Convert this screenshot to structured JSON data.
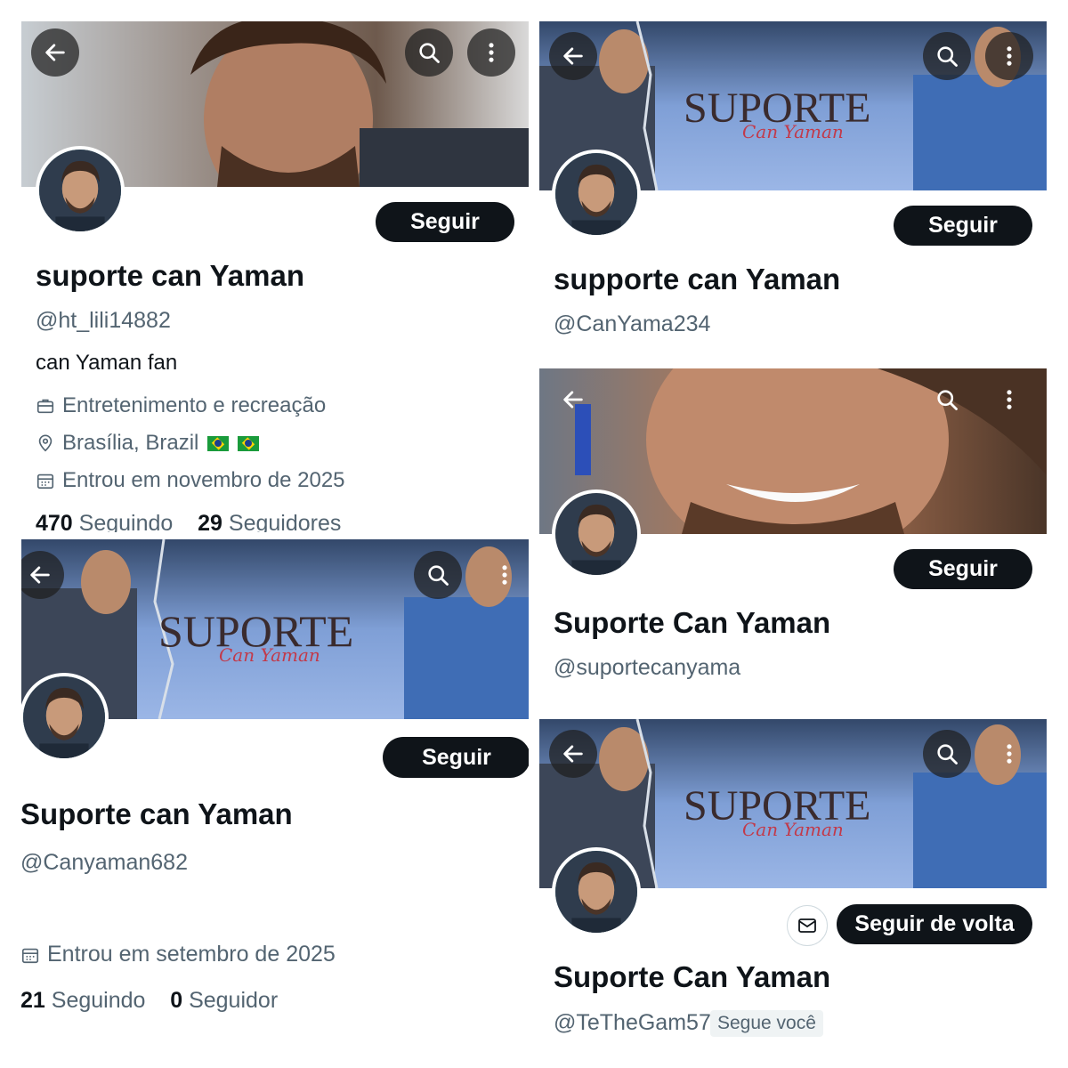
{
  "panels": {
    "p1": {
      "name": "suporte can Yaman",
      "handle": "@ht_lili14882",
      "bio": "can Yaman fan",
      "category": "Entretenimento e recreação",
      "location": "Brasília, Brazil",
      "joined": "Entrou em novembro de 2025",
      "following_count": "470",
      "following_label": "Seguindo",
      "followers_count": "29",
      "followers_label": "Seguidores",
      "follow_label": "Seguir"
    },
    "p2": {
      "name": "supporte can Yaman",
      "handle": "@CanYama234",
      "banner_title": "SUPORTE",
      "banner_sub": "Can Yaman",
      "follow_label": "Seguir"
    },
    "p3": {
      "name": "Suporte can Yaman",
      "handle": "@Canyaman682",
      "banner_title": "SUPORTE",
      "banner_sub": "Can Yaman",
      "joined": "Entrou em setembro de 2025",
      "following_count": "21",
      "following_label": "Seguindo",
      "followers_count": "0",
      "followers_label": "Seguidor",
      "follow_label": "Seguir"
    },
    "p4": {
      "name": "Suporte Can Yaman",
      "handle": "@suportecanyama",
      "follow_label": "Seguir"
    },
    "p5": {
      "name": "Suporte Can Yaman",
      "handle": "@TeTheGam57",
      "follows_you": "Segue você",
      "banner_title": "SUPORTE",
      "banner_sub": "Can Yaman",
      "follow_label": "Seguir de volta"
    }
  },
  "icons": {
    "back": "arrow-left-icon",
    "search": "search-icon",
    "more": "more-vertical-icon",
    "briefcase": "briefcase-icon",
    "location": "location-pin-icon",
    "calendar": "calendar-icon",
    "mail": "mail-icon"
  },
  "colors": {
    "banner_blue": "#8aa7d8",
    "button_dark": "#0f1419",
    "handle_gray": "#536471",
    "avatar_ring": "#5bd3d5"
  }
}
